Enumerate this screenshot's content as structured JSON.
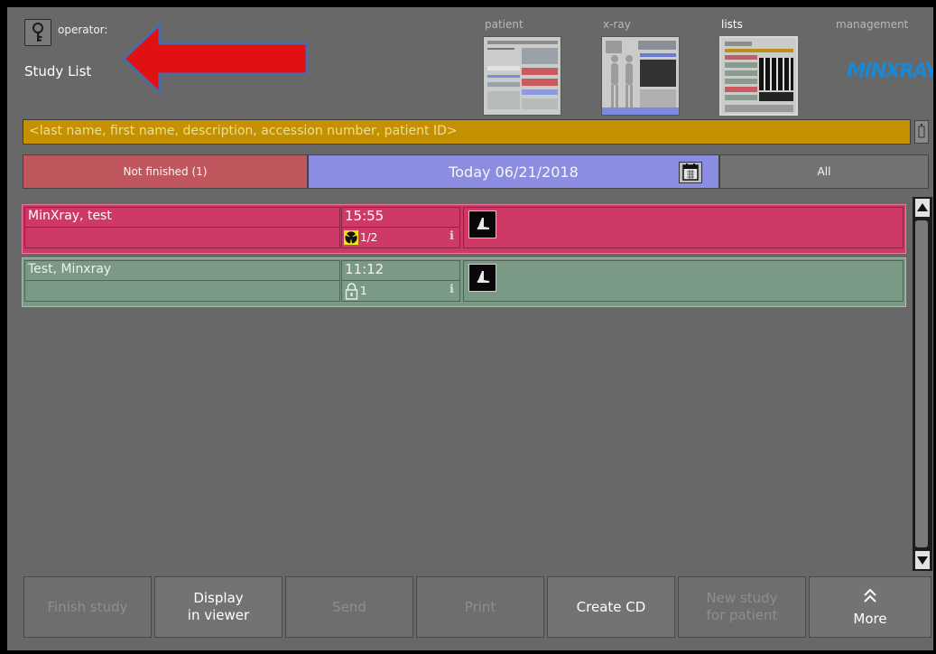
{
  "header": {
    "operator_label": "operator:",
    "page_title": "Study List"
  },
  "nav": [
    {
      "label": "patient"
    },
    {
      "label": "x-ray"
    },
    {
      "label": "lists"
    },
    {
      "label": "management"
    }
  ],
  "logo": "MINXRAY",
  "search": {
    "placeholder": "<last name, first name, description, accession number, patient ID>"
  },
  "filters": {
    "not_finished": "Not finished (1)",
    "date": "Today 06/21/2018",
    "all": "All"
  },
  "studies": [
    {
      "name": "MinXray, test",
      "time": "15:55",
      "count": "1/2",
      "status_icon": "radiation-icon"
    },
    {
      "name": "Test, Minxray",
      "time": "11:12",
      "count": "1",
      "status_icon": "lock-icon"
    }
  ],
  "toolbar": {
    "finish": "Finish study",
    "display_l1": "Display",
    "display_l2": "in viewer",
    "send": "Send",
    "print": "Print",
    "create_cd": "Create CD",
    "new_l1": "New study",
    "new_l2": "for patient",
    "more": "More"
  },
  "colors": {
    "row_active": "#cf3966",
    "row_finished": "#7a9a86",
    "search_bg": "#c59100",
    "today_bg": "#8b8ee0",
    "not_finished_bg": "#c0575e",
    "annotation_arrow": "#e11111",
    "logo": "#1789d8"
  }
}
